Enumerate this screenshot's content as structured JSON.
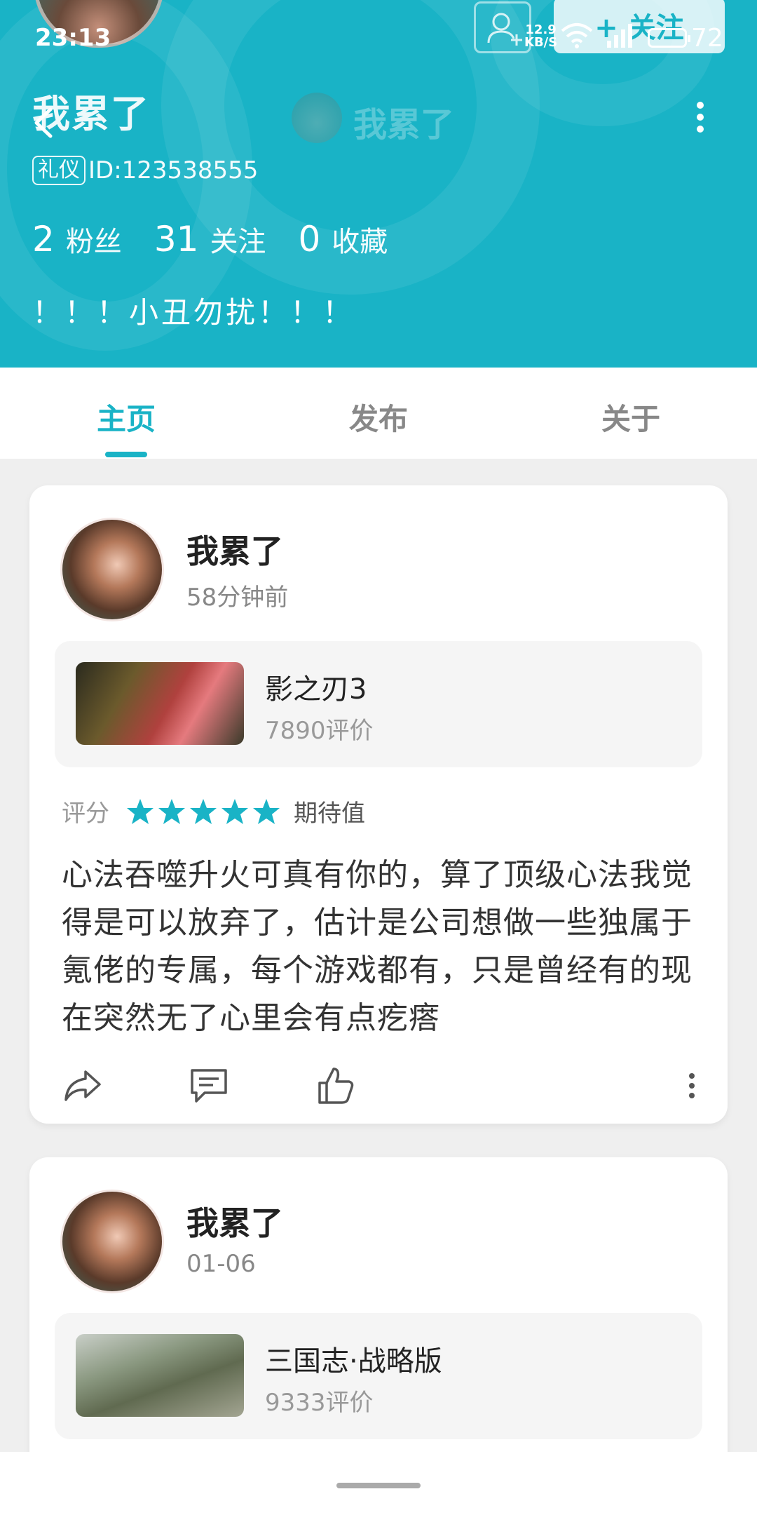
{
  "status_bar": {
    "time": "23:13",
    "net_speed_value": "12.9",
    "net_speed_unit": "KB/S",
    "battery": "72"
  },
  "header": {
    "follow_button": "+ 关注",
    "username": "我累了",
    "collapsed_title": "我累了",
    "badge": "礼仪",
    "user_id": "ID:123538555",
    "stats": [
      {
        "value": "2",
        "label": "粉丝"
      },
      {
        "value": "31",
        "label": "关注"
      },
      {
        "value": "0",
        "label": "收藏"
      }
    ],
    "bio": "！！！小丑勿扰！！！",
    "accent_color": "#19b3c6"
  },
  "tabs": [
    {
      "label": "主页",
      "active": true
    },
    {
      "label": "发布",
      "active": false
    },
    {
      "label": "关于",
      "active": false
    }
  ],
  "posts": [
    {
      "author": "我累了",
      "time": "58分钟前",
      "game": {
        "name": "影之刃3",
        "reviews": "7890评价"
      },
      "rating_label": "评分",
      "stars": 5,
      "rating_type": "期待值",
      "content": "心法吞噬升火可真有你的，算了顶级心法我觉得是可以放弃了，估计是公司想做一些独属于氪佬的专属，每个游戏都有，只是曾经有的现在突然无了心里会有点疙瘩"
    },
    {
      "author": "我累了",
      "time": "01-06",
      "game": {
        "name": "三国志·战略版",
        "reviews": "9333评价"
      }
    }
  ]
}
